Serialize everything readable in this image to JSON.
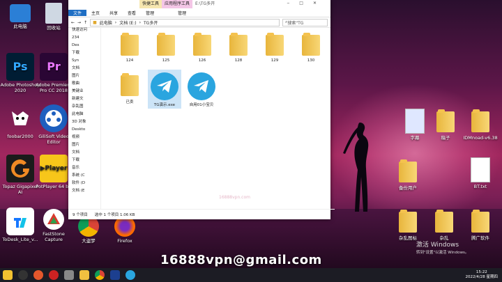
{
  "desktop_left": [
    {
      "label": "此电脑",
      "name": "this-pc-icon"
    },
    {
      "label": "回收站",
      "name": "recycle-bin-icon"
    },
    {
      "label": "Adobe Photoshop 2020",
      "name": "photoshop-icon"
    },
    {
      "label": "Adobe Premiere Pro CC 2018",
      "name": "premiere-icon"
    },
    {
      "label": "foobar2000",
      "name": "foobar-icon"
    },
    {
      "label": "GiliSoft Video Editor",
      "name": "video-editor-icon"
    },
    {
      "label": "Topaz Gigapixel AI",
      "name": "topaz-icon"
    },
    {
      "label": "PotPlayer 64 bit",
      "name": "potplayer-icon"
    },
    {
      "label": "ToDesk_Lite_v...",
      "name": "todesk-icon"
    },
    {
      "label": "FastStone Capture",
      "name": "faststone-icon"
    },
    {
      "label": "大盗梦",
      "name": "chrome-icon"
    },
    {
      "label": "Firefox",
      "name": "firefox-icon"
    }
  ],
  "desktop_right": [
    {
      "label": "字幕"
    },
    {
      "label": "稿子"
    },
    {
      "label": "IDMnoad-v6.38"
    },
    {
      "label": "备份用户"
    },
    {
      "label": "BT.txt"
    },
    {
      "label": "杂乱图标"
    },
    {
      "label": "杂乱"
    },
    {
      "label": "腾广软件"
    }
  ],
  "explorer": {
    "title_tab1": "快捷工具",
    "title_tab2": "应用程序工具",
    "title_path": "E:\\TG多开",
    "ribbon": [
      "文件",
      "主页",
      "共享",
      "查看",
      "管理",
      "管理"
    ],
    "breadcrumb": [
      "此电脑",
      "文档 (E:)",
      "TG多开"
    ],
    "search_placeholder": "搜索\"TG",
    "nav": [
      "快速访问",
      "234",
      "Des",
      "下载",
      "Syn",
      "文档",
      "图片",
      "歌曲",
      "美键业",
      "新建文",
      "杂乱图",
      "此电脑",
      "3D 对象",
      "Deskto",
      "视频",
      "图片",
      "文档",
      "下载",
      "音乐",
      "系统 (C",
      "软件 (D",
      "文档 (E"
    ],
    "files": [
      {
        "label": "124"
      },
      {
        "label": "125"
      },
      {
        "label": "126"
      },
      {
        "label": "128"
      },
      {
        "label": "129"
      },
      {
        "label": "130"
      },
      {
        "label": "已卖"
      },
      {
        "label": "TG演示.exe"
      },
      {
        "label": "自用01小宝贝"
      }
    ],
    "status": {
      "count": "9 个项目",
      "selection": "选中 1 个项目  1.06 KB"
    },
    "overlay": "16888vpn.com"
  },
  "watermark": "16888vpn@gmail.com",
  "activate": {
    "line1": "激活 Windows",
    "line2": "转到\"设置\"以激活 Windows。"
  },
  "clock": {
    "time": "15:22",
    "date": "2022/4/28 星期四"
  }
}
